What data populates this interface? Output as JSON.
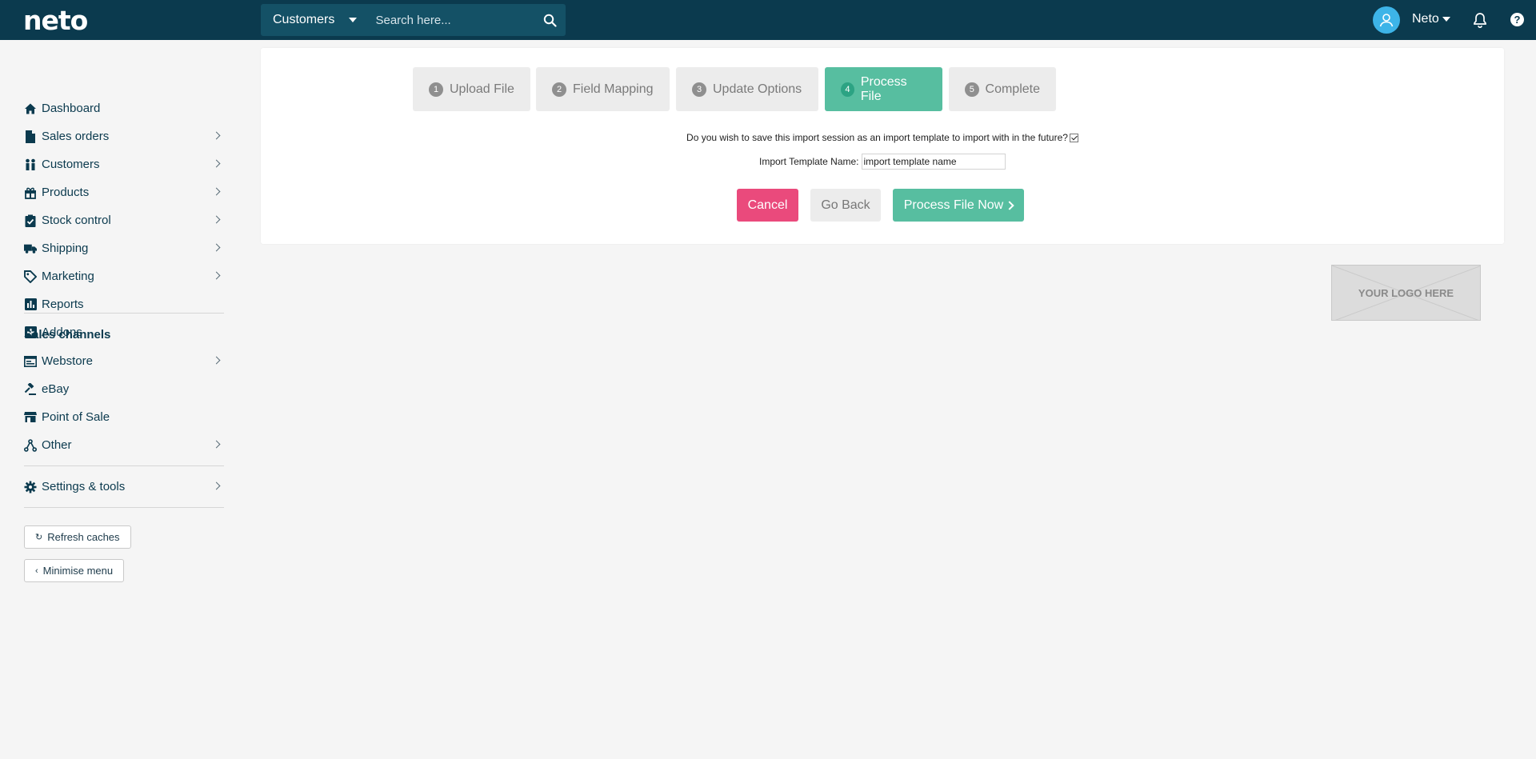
{
  "header": {
    "logo_text": "neto",
    "search_scope": "Customers",
    "search_placeholder": "Search here...",
    "user_name": "Neto",
    "help_symbol": "?"
  },
  "sidebar": {
    "items": [
      {
        "label": "Dashboard",
        "icon": "home-icon"
      },
      {
        "label": "Sales orders",
        "icon": "document-icon"
      },
      {
        "label": "Customers",
        "icon": "customers-icon"
      },
      {
        "label": "Products",
        "icon": "gift-icon"
      },
      {
        "label": "Stock control",
        "icon": "clipboard-check-icon"
      },
      {
        "label": "Shipping",
        "icon": "truck-icon"
      },
      {
        "label": "Marketing",
        "icon": "tag-icon"
      },
      {
        "label": "Reports",
        "icon": "bar-chart-icon"
      },
      {
        "label": "Addons",
        "icon": "plus-square-icon"
      }
    ],
    "sales_channels_title": "Sales channels",
    "channels": [
      {
        "label": "Webstore",
        "icon": "browser-icon"
      },
      {
        "label": "eBay",
        "icon": "gavel-icon"
      },
      {
        "label": "Point of Sale",
        "icon": "store-icon"
      },
      {
        "label": "Other",
        "icon": "network-icon"
      }
    ],
    "settings_label": "Settings & tools",
    "refresh_label": "Refresh caches",
    "minimise_label": "Minimise menu"
  },
  "wizard": {
    "steps": [
      {
        "num": "1",
        "label": "Upload File"
      },
      {
        "num": "2",
        "label": "Field Mapping"
      },
      {
        "num": "3",
        "label": "Update Options"
      },
      {
        "num": "4",
        "label": "Process File"
      },
      {
        "num": "5",
        "label": "Complete"
      }
    ],
    "active_step": 4,
    "save_question": "Do you wish to save this import session as an import template to import with in the future?",
    "save_checked": true,
    "template_label": "Import Template Name:",
    "template_value": "import template name",
    "cancel_label": "Cancel",
    "back_label": "Go Back",
    "process_label": "Process File Now"
  },
  "logo_placeholder": "YOUR LOGO HERE",
  "colors": {
    "topbar": "#0b3a4e",
    "accent_green": "#57bea0",
    "cancel_pink": "#ea4a7c",
    "avatar_blue": "#3db4e8"
  }
}
